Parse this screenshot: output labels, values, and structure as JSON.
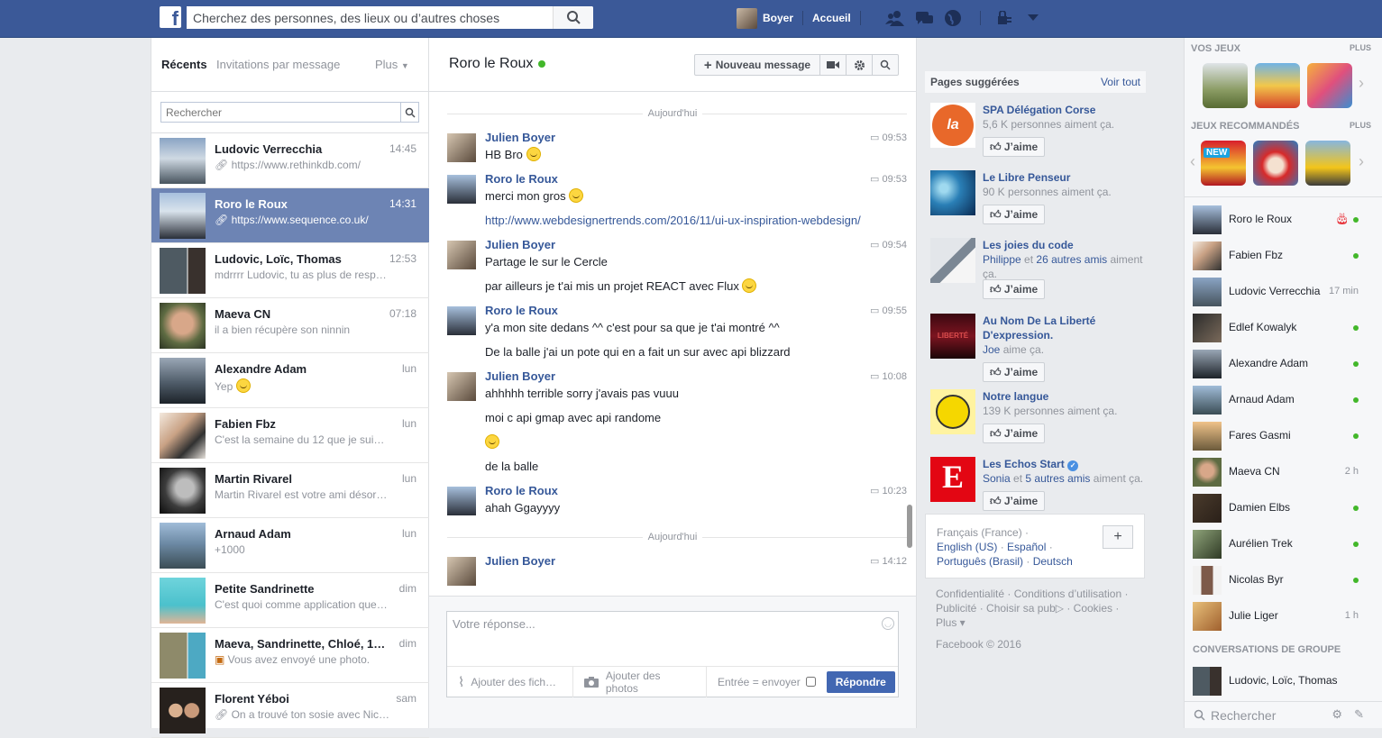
{
  "topbar": {
    "search_placeholder": "Cherchez des personnes, des lieux ou d’autres choses",
    "user_name": "Boyer",
    "home_label": "Accueil"
  },
  "left": {
    "tabs": [
      "Récents",
      "Invitations par message",
      "Plus"
    ],
    "search_placeholder": "Rechercher",
    "threads": [
      {
        "name": "Ludovic Verrecchia",
        "time": "14:45",
        "snippet": "https://www.rethinkdb.com/",
        "selected": false
      },
      {
        "name": "Roro le Roux",
        "time": "14:31",
        "snippet": "https://www.sequence.co.uk/",
        "selected": true
      },
      {
        "name": "Ludovic, Loïc, Thomas",
        "time": "12:53",
        "snippet": "mdrrrr Ludovic, tu as plus de resp…"
      },
      {
        "name": "Maeva CN",
        "time": "07:18",
        "snippet": "il a bien récupère son ninnin"
      },
      {
        "name": "Alexandre Adam",
        "time": "lun",
        "snippet": "Yep"
      },
      {
        "name": "Fabien Fbz",
        "time": "lun",
        "snippet": "C'est la semaine du 12 que je sui…"
      },
      {
        "name": "Martin Rivarel",
        "time": "lun",
        "snippet": "Martin Rivarel est votre ami désor…"
      },
      {
        "name": "Arnaud Adam",
        "time": "lun",
        "snippet": "+1000"
      },
      {
        "name": "Petite Sandrinette",
        "time": "dim",
        "snippet": "C'est quoi comme application que…"
      },
      {
        "name": "Maeva, Sandrinette, Chloé, 1 a…",
        "time": "dim",
        "snippet": "Vous avez envoyé une photo."
      },
      {
        "name": "Florent Yéboi",
        "time": "sam",
        "snippet": "On a trouvé ton sosie avec Nic…"
      }
    ]
  },
  "center": {
    "conversation_name": "Roro le Roux",
    "new_message_label": "Nouveau message",
    "day_separator": "Aujourd'hui",
    "groups": [
      {
        "sender": "Julien Boyer",
        "time": "09:53",
        "lines": [
          "HB Bro"
        ]
      },
      {
        "sender": "Roro le Roux",
        "time": "09:53",
        "lines": [
          "merci mon gros",
          "http://www.webdesignertrends.com/2016/11/ui-ux-inspiration-webdesign/"
        ]
      },
      {
        "sender": "Julien Boyer",
        "time": "09:54",
        "lines": [
          "Partage le sur le Cercle",
          "par ailleurs je t'ai mis un projet REACT avec Flux"
        ]
      },
      {
        "sender": "Roro le Roux",
        "time": "09:55",
        "lines": [
          "y'a mon site dedans ^^ c'est pour sa que je t'ai montré ^^",
          "De la balle j'ai un pote qui en a fait un sur avec api blizzard"
        ]
      },
      {
        "sender": "Julien Boyer",
        "time": "10:08",
        "lines": [
          "ahhhhh terrible sorry j'avais pas vuuu",
          "moi c api gmap avec api randome",
          "de la balle"
        ]
      },
      {
        "sender": "Roro le Roux",
        "time": "10:23",
        "lines": [
          "ahah Ggayyyy"
        ]
      },
      {
        "sender": "Julien Boyer",
        "time": "14:12",
        "lines": []
      }
    ],
    "reply_placeholder": "Votre réponse...",
    "attach_file_label": "Ajouter des fich…",
    "attach_photo_label": "Ajouter des photos",
    "enter_send_label": "Entrée = envoyer",
    "reply_button": "Répondre"
  },
  "pages": {
    "title": "Pages suggérées",
    "see_all": "Voir tout",
    "like_label": "J’aime",
    "items": [
      {
        "name": "SPA Délégation Corse",
        "likes": "5,6 K personnes aiment ça."
      },
      {
        "name": "Le Libre Penseur",
        "likes": "90 K personnes aiment ça."
      },
      {
        "name": "Les joies du code",
        "friend": "Philippe",
        "et": "et",
        "others": "26 autres amis",
        "suffix": "aiment ça."
      },
      {
        "name": "Au Nom De La Liberté D'expression.",
        "friend": "Joe",
        "suffix": "aime ça."
      },
      {
        "name": "Notre langue",
        "likes": "139 K personnes aiment ça."
      },
      {
        "name": "Les Echos Start",
        "friend": "Sonia",
        "et": "et",
        "others": "5 autres amis",
        "suffix": "aiment ça."
      }
    ]
  },
  "languages": {
    "current": "Français (France) ·",
    "links": [
      "English (US)",
      "Español",
      "Português (Brasil)",
      "Deutsch"
    ]
  },
  "footer": {
    "links": [
      "Confidentialité ·",
      "Conditions d’utilisation ·",
      "Publicité ·",
      "Choisir sa pub",
      "·",
      "Cookies ·",
      "Plus ▾"
    ],
    "copyright": "Facebook © 2016"
  },
  "sidebar": {
    "my_games": "VOS JEUX",
    "recommended_games": "JEUX RECOMMANDÉS",
    "more": "PLUS",
    "new_badge": "NEW",
    "group_conversations": "CONVERSATIONS DE GROUPE",
    "search_placeholder": "Rechercher",
    "contacts": [
      {
        "name": "Roro le Roux",
        "status": ""
      },
      {
        "name": "Fabien Fbz",
        "status": ""
      },
      {
        "name": "Ludovic Verrecchia",
        "status": "17 min"
      },
      {
        "name": "Edlef Kowalyk",
        "status": ""
      },
      {
        "name": "Alexandre Adam",
        "status": ""
      },
      {
        "name": "Arnaud Adam",
        "status": ""
      },
      {
        "name": "Fares Gasmi",
        "status": ""
      },
      {
        "name": "Maeva CN",
        "status": "2 h"
      },
      {
        "name": "Damien Elbs",
        "status": ""
      },
      {
        "name": "Aurélien Trek",
        "status": ""
      },
      {
        "name": "Nicolas Byr",
        "status": ""
      },
      {
        "name": "Julie Liger",
        "status": "1 h"
      }
    ],
    "group": {
      "name": "Ludovic, Loïc, Thomas"
    }
  },
  "colors": {
    "brand": "#3b5998",
    "selected": "#6d84b4",
    "online": "#42b72a",
    "link": "#365899"
  }
}
